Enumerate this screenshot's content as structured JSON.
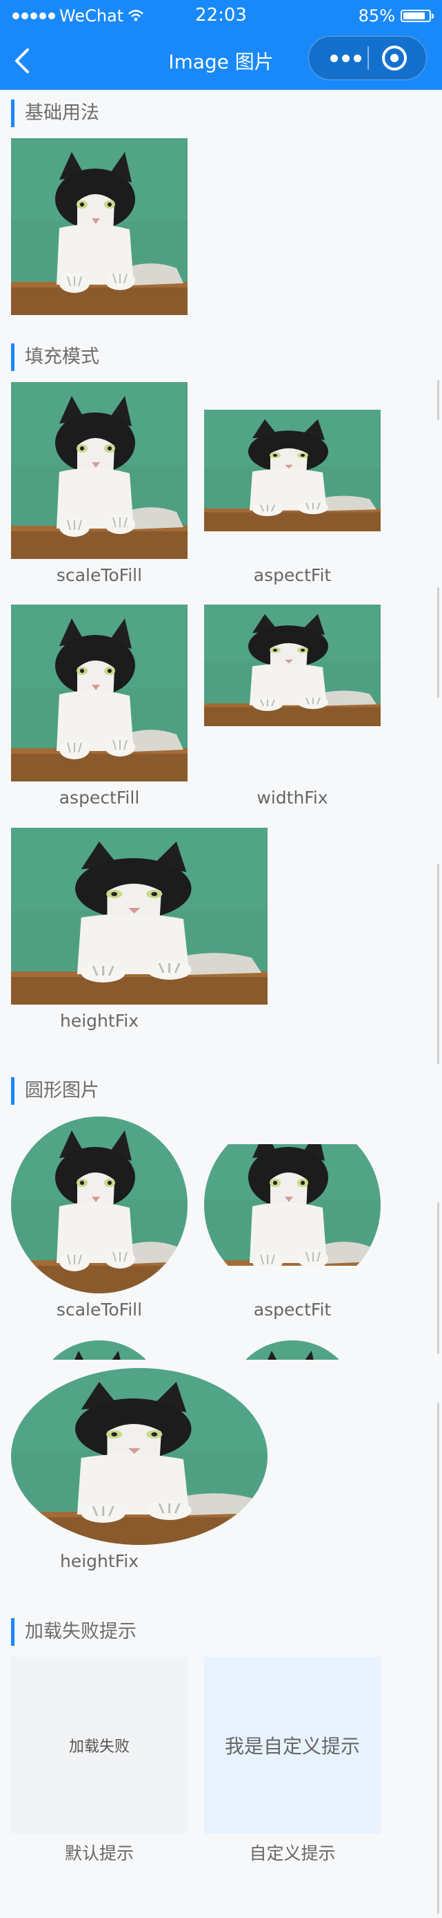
{
  "status_bar": {
    "carrier": "WeChat",
    "time": "22:03",
    "battery": "85%"
  },
  "nav": {
    "title": "Image 图片"
  },
  "sections": {
    "basic": {
      "title": "基础用法"
    },
    "fill": {
      "title": "填充模式",
      "modes": [
        "scaleToFill",
        "aspectFit",
        "aspectFill",
        "widthFix",
        "heightFix"
      ]
    },
    "round": {
      "title": "圆形图片",
      "modes": [
        "scaleToFill",
        "aspectFit",
        "heightFix"
      ]
    },
    "error": {
      "title": "加载失败提示",
      "default_text": "加载失败",
      "custom_text": "我是自定义提示",
      "default_caption": "默认提示",
      "custom_caption": "自定义提示"
    }
  },
  "colors": {
    "brand": "#1989fa",
    "photo_bg": "#4fa083"
  }
}
